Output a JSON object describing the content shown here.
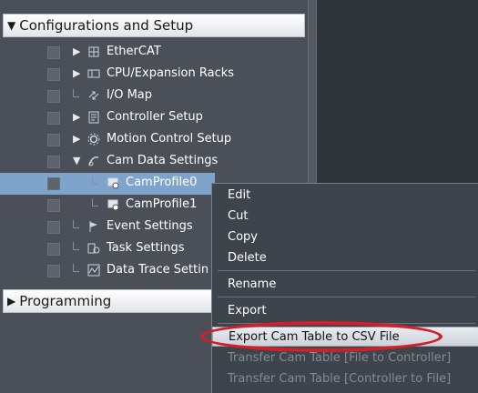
{
  "colors": {
    "panel_bg": "#4b5058",
    "selection": "#7fa4cc",
    "highlight_ring": "#d2202a",
    "menu_bg": "#3e444b"
  },
  "sections": {
    "config": {
      "label": "Configurations and Setup",
      "expanded": true
    },
    "programming": {
      "label": "Programming",
      "expanded": false
    }
  },
  "tree": [
    {
      "label": "EtherCAT",
      "icon": "ethercat-icon",
      "expandable": true
    },
    {
      "label": "CPU/Expansion Racks",
      "icon": "rack-icon",
      "expandable": true
    },
    {
      "label": "I/O Map",
      "icon": "io-map-icon",
      "expandable": false
    },
    {
      "label": "Controller Setup",
      "icon": "controller-icon",
      "expandable": true
    },
    {
      "label": "Motion Control Setup",
      "icon": "gear-icon",
      "expandable": true
    },
    {
      "label": "Cam Data Settings",
      "icon": "cam-icon",
      "expandable": true,
      "expanded": true
    },
    {
      "label": "CamProfile0",
      "icon": "cam-profile-icon",
      "selected": true
    },
    {
      "label": "CamProfile1",
      "icon": "cam-profile-icon"
    },
    {
      "label": "Event Settings",
      "icon": "flag-icon"
    },
    {
      "label": "Task Settings",
      "icon": "task-icon"
    },
    {
      "label": "Data Trace Settin",
      "icon": "trace-icon"
    }
  ],
  "context_menu": [
    {
      "label": "Edit",
      "enabled": true
    },
    {
      "label": "Cut",
      "enabled": true
    },
    {
      "label": "Copy",
      "enabled": true
    },
    {
      "label": "Delete",
      "enabled": true
    },
    {
      "label": "Rename",
      "enabled": true
    },
    {
      "label": "Export",
      "enabled": true
    },
    {
      "label": "Export Cam Table to CSV File",
      "enabled": true,
      "highlighted": true
    },
    {
      "label": "Transfer Cam Table [File to Controller]",
      "enabled": false
    },
    {
      "label": "Transfer Cam Table [Controller to File]",
      "enabled": false
    }
  ]
}
